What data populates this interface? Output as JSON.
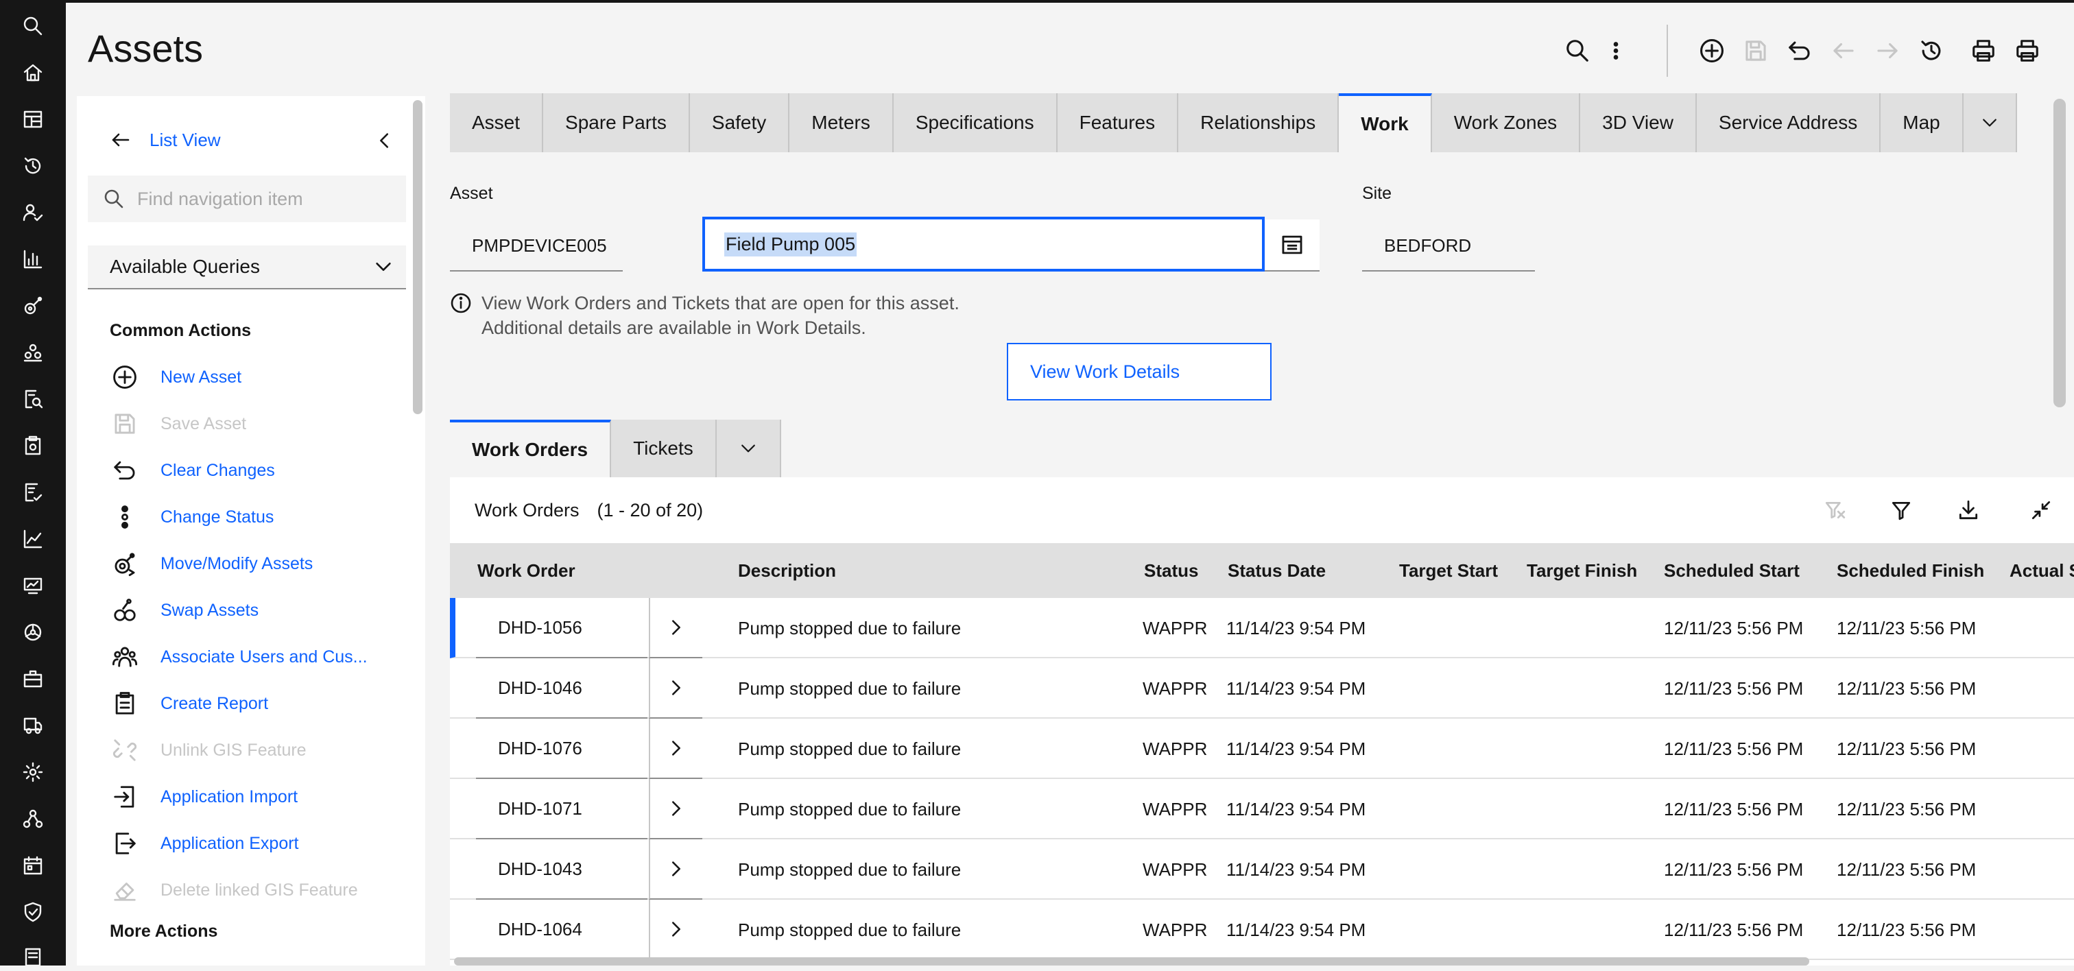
{
  "page": {
    "title": "Assets"
  },
  "rail": {
    "icons": [
      "search-icon",
      "home-icon",
      "dashboard-icon",
      "history-icon",
      "user-check-icon",
      "analytics-icon",
      "asset-icon",
      "groups-icon",
      "inspection-icon",
      "clipboard-icon",
      "report-icon",
      "trend-icon",
      "monitor-icon",
      "settings-wheel-icon",
      "toolbox-icon",
      "delivery-icon",
      "settings-icon",
      "network-icon",
      "calendar-icon",
      "shield-check-icon",
      "document-icon"
    ]
  },
  "toolbar": {
    "icons": [
      "search-icon",
      "overflow-menu-icon",
      "add-icon",
      "save-icon",
      "undo-icon",
      "previous-icon",
      "next-icon",
      "history-icon",
      "print-icon",
      "print-all-icon"
    ]
  },
  "sidenav": {
    "back_label": "List View",
    "search_placeholder": "Find navigation item",
    "queries_label": "Available Queries",
    "common_actions_heading": "Common Actions",
    "more_actions_heading": "More Actions",
    "actions": [
      {
        "label": "New Asset",
        "icon": "add-circle-icon",
        "enabled": true
      },
      {
        "label": "Save Asset",
        "icon": "save-icon",
        "enabled": false
      },
      {
        "label": "Clear Changes",
        "icon": "undo-icon",
        "enabled": true
      },
      {
        "label": "Change Status",
        "icon": "status-dots-icon",
        "enabled": true
      },
      {
        "label": "Move/Modify Assets",
        "icon": "move-asset-icon",
        "enabled": true
      },
      {
        "label": "Swap Assets",
        "icon": "swap-asset-icon",
        "enabled": true
      },
      {
        "label": "Associate Users and Cus...",
        "icon": "users-icon",
        "enabled": true
      },
      {
        "label": "Create Report",
        "icon": "report-icon",
        "enabled": true
      },
      {
        "label": "Unlink GIS Feature",
        "icon": "unlink-icon",
        "enabled": false
      },
      {
        "label": "Application Import",
        "icon": "import-icon",
        "enabled": true
      },
      {
        "label": "Application Export",
        "icon": "export-icon",
        "enabled": true
      },
      {
        "label": "Delete linked GIS Feature",
        "icon": "erase-icon",
        "enabled": false
      }
    ]
  },
  "tabs": [
    "Asset",
    "Spare Parts",
    "Safety",
    "Meters",
    "Specifications",
    "Features",
    "Relationships",
    "Work",
    "Work Zones",
    "3D View",
    "Service Address",
    "Map"
  ],
  "active_tab": "Work",
  "fields": {
    "asset_label": "Asset",
    "asset_value": "PMPDEVICE005",
    "description_value": "Field Pump 005",
    "site_label": "Site",
    "site_value": "BEDFORD"
  },
  "info": {
    "line1": "View Work Orders and Tickets that are open for this asset.",
    "line2": "Additional details are available in Work Details."
  },
  "view_work_details_label": "View Work Details",
  "subtabs": [
    "Work Orders",
    "Tickets"
  ],
  "table": {
    "title": "Work Orders",
    "count": "(1 - 20 of 20)",
    "columns": [
      "Work Order",
      "Description",
      "Status",
      "Status Date",
      "Target Start",
      "Target Finish",
      "Scheduled Start",
      "Scheduled Finish",
      "Actual S"
    ],
    "rows": [
      {
        "wo": "DHD-1056",
        "desc": "Pump stopped due to failure",
        "status": "WAPPR",
        "status_date": "11/14/23 9:54 PM",
        "target_start": "",
        "target_finish": "",
        "sched_start": "12/11/23 5:56 PM",
        "sched_finish": "12/11/23 5:56 PM"
      },
      {
        "wo": "DHD-1046",
        "desc": "Pump stopped due to failure",
        "status": "WAPPR",
        "status_date": "11/14/23 9:54 PM",
        "target_start": "",
        "target_finish": "",
        "sched_start": "12/11/23 5:56 PM",
        "sched_finish": "12/11/23 5:56 PM"
      },
      {
        "wo": "DHD-1076",
        "desc": "Pump stopped due to failure",
        "status": "WAPPR",
        "status_date": "11/14/23 9:54 PM",
        "target_start": "",
        "target_finish": "",
        "sched_start": "12/11/23 5:56 PM",
        "sched_finish": "12/11/23 5:56 PM"
      },
      {
        "wo": "DHD-1071",
        "desc": "Pump stopped due to failure",
        "status": "WAPPR",
        "status_date": "11/14/23 9:54 PM",
        "target_start": "",
        "target_finish": "",
        "sched_start": "12/11/23 5:56 PM",
        "sched_finish": "12/11/23 5:56 PM"
      },
      {
        "wo": "DHD-1043",
        "desc": "Pump stopped due to failure",
        "status": "WAPPR",
        "status_date": "11/14/23 9:54 PM",
        "target_start": "",
        "target_finish": "",
        "sched_start": "12/11/23 5:56 PM",
        "sched_finish": "12/11/23 5:56 PM"
      },
      {
        "wo": "DHD-1064",
        "desc": "Pump stopped due to failure",
        "status": "WAPPR",
        "status_date": "11/14/23 9:54 PM",
        "target_start": "",
        "target_finish": "",
        "sched_start": "12/11/23 5:56 PM",
        "sched_finish": "12/11/23 5:56 PM"
      }
    ]
  },
  "colors": {
    "accent": "#0f62fe",
    "rail": "#161616",
    "disabled": "#c6c6c6"
  }
}
